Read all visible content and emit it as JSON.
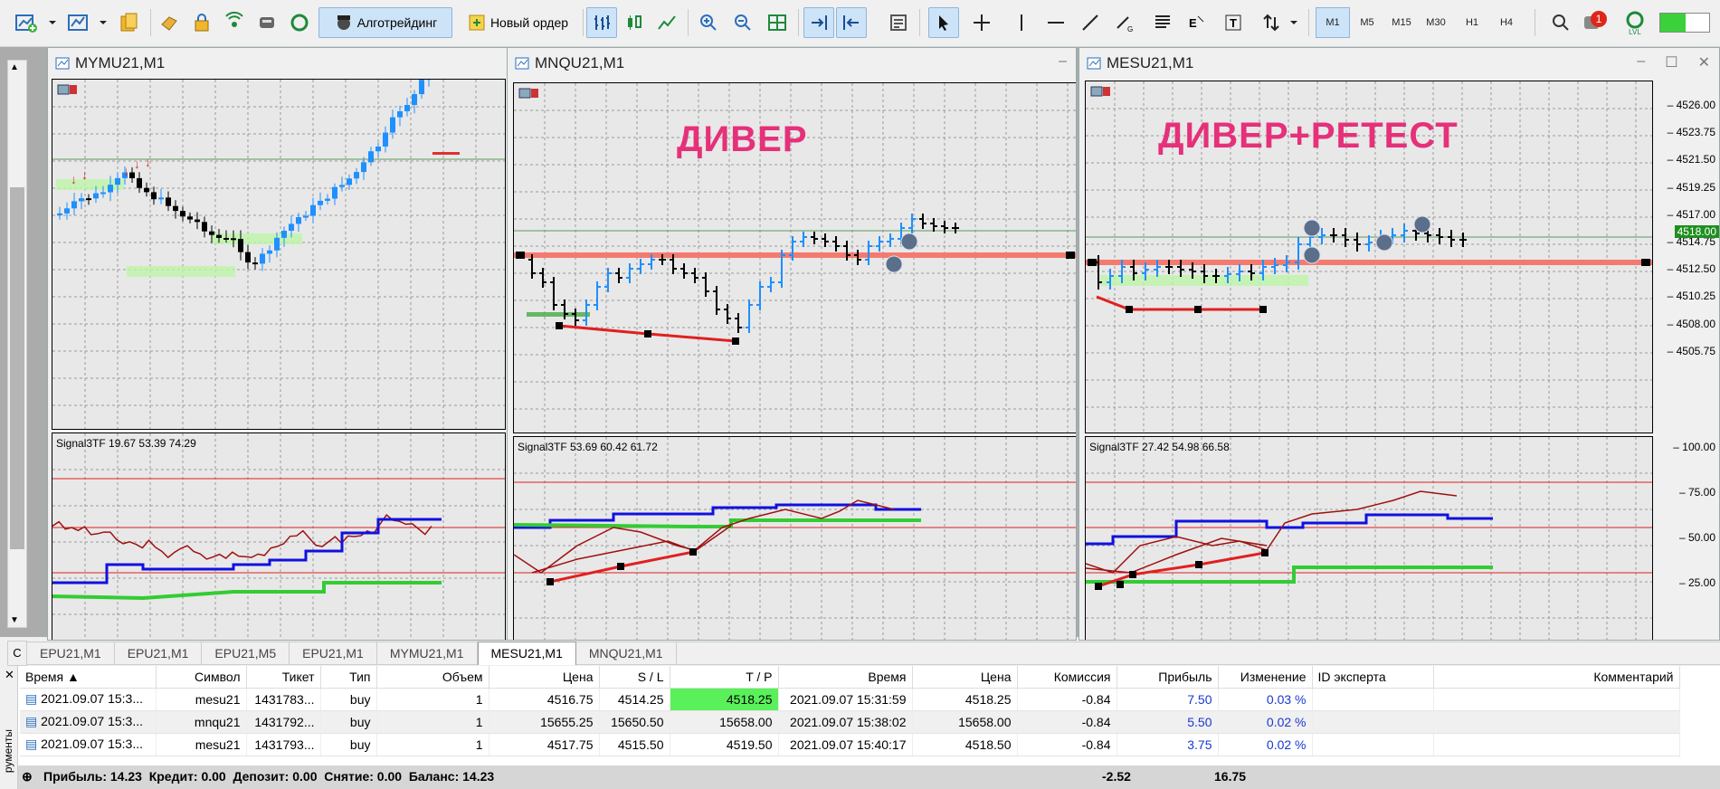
{
  "toolbar": {
    "algotrading_label": "Алготрейдинг",
    "new_order_label": "Новый ордер",
    "timeframes": [
      "M1",
      "M5",
      "M15",
      "M30",
      "H1",
      "H4"
    ],
    "active_timeframe": "M1",
    "notification_count": "1",
    "lvl_label": "LVL"
  },
  "windows": [
    {
      "title": "MYMU21,M1",
      "indicator_label": "Signal3TF 19.67 53.39 74.29"
    },
    {
      "title": "MNQU21,M1",
      "annotation": "ДИВЕР",
      "indicator_label": "Signal3TF 53.69 60.42 61.72"
    },
    {
      "title": "MESU21,M1",
      "annotation": "ДИВЕР+РЕТЕСТ",
      "indicator_label": "Signal3TF 27.42 54.98 66.58",
      "price_ticks": [
        "4526.00",
        "4523.75",
        "4521.50",
        "4519.25",
        "4517.00",
        "4514.75",
        "4512.50",
        "4510.25",
        "4508.00",
        "4505.75"
      ],
      "current_price": "4518.00",
      "indicator_ticks": [
        "100.00",
        "75.00",
        "50.00",
        "25.00"
      ]
    }
  ],
  "chart_tabs": [
    "EPU21,M1",
    "EPU21,M1",
    "EPU21,M5",
    "EPU21,M1",
    "MYMU21,M1",
    "MESU21,M1",
    "MNQU21,M1"
  ],
  "active_tab_index": 5,
  "terminal": {
    "close_glyph": "✕",
    "side_label": "рументы",
    "columns": [
      "Время",
      "Символ",
      "Тикет",
      "Тип",
      "Объем",
      "Цена",
      "S / L",
      "T / P",
      "Время",
      "Цена",
      "Комиссия",
      "Прибыль",
      "Изменение",
      "ID эксперта",
      "Комментарий"
    ],
    "rows": [
      [
        "2021.09.07 15:3...",
        "mesu21",
        "1431783...",
        "buy",
        "1",
        "4516.75",
        "4514.25",
        "4518.25",
        "2021.09.07 15:31:59",
        "4518.25",
        "-0.84",
        "7.50",
        "0.03 %",
        "",
        ""
      ],
      [
        "2021.09.07 15:3...",
        "mnqu21",
        "1431792...",
        "buy",
        "1",
        "15655.25",
        "15650.50",
        "15658.00",
        "2021.09.07 15:38:02",
        "15658.00",
        "-0.84",
        "5.50",
        "0.02 %",
        "",
        ""
      ],
      [
        "2021.09.07 15:3...",
        "mesu21",
        "1431793...",
        "buy",
        "1",
        "4517.75",
        "4515.50",
        "4519.50",
        "2021.09.07 15:40:17",
        "4518.50",
        "-0.84",
        "3.75",
        "0.02 %",
        "",
        ""
      ]
    ],
    "summary": {
      "text": "Прибыль: 14.23  Кредит: 0.00  Депозит: 0.00  Снятие: 0.00  Баланс: 14.23",
      "commission_total": "-2.52",
      "profit_total": "16.75"
    }
  },
  "colors": {
    "accent_red": "#e6307a",
    "tp_green": "#5af05a",
    "bull": "#1e90ff",
    "line_blue": "#1010e0",
    "line_green": "#33cc33",
    "line_dark": "#a01010"
  }
}
